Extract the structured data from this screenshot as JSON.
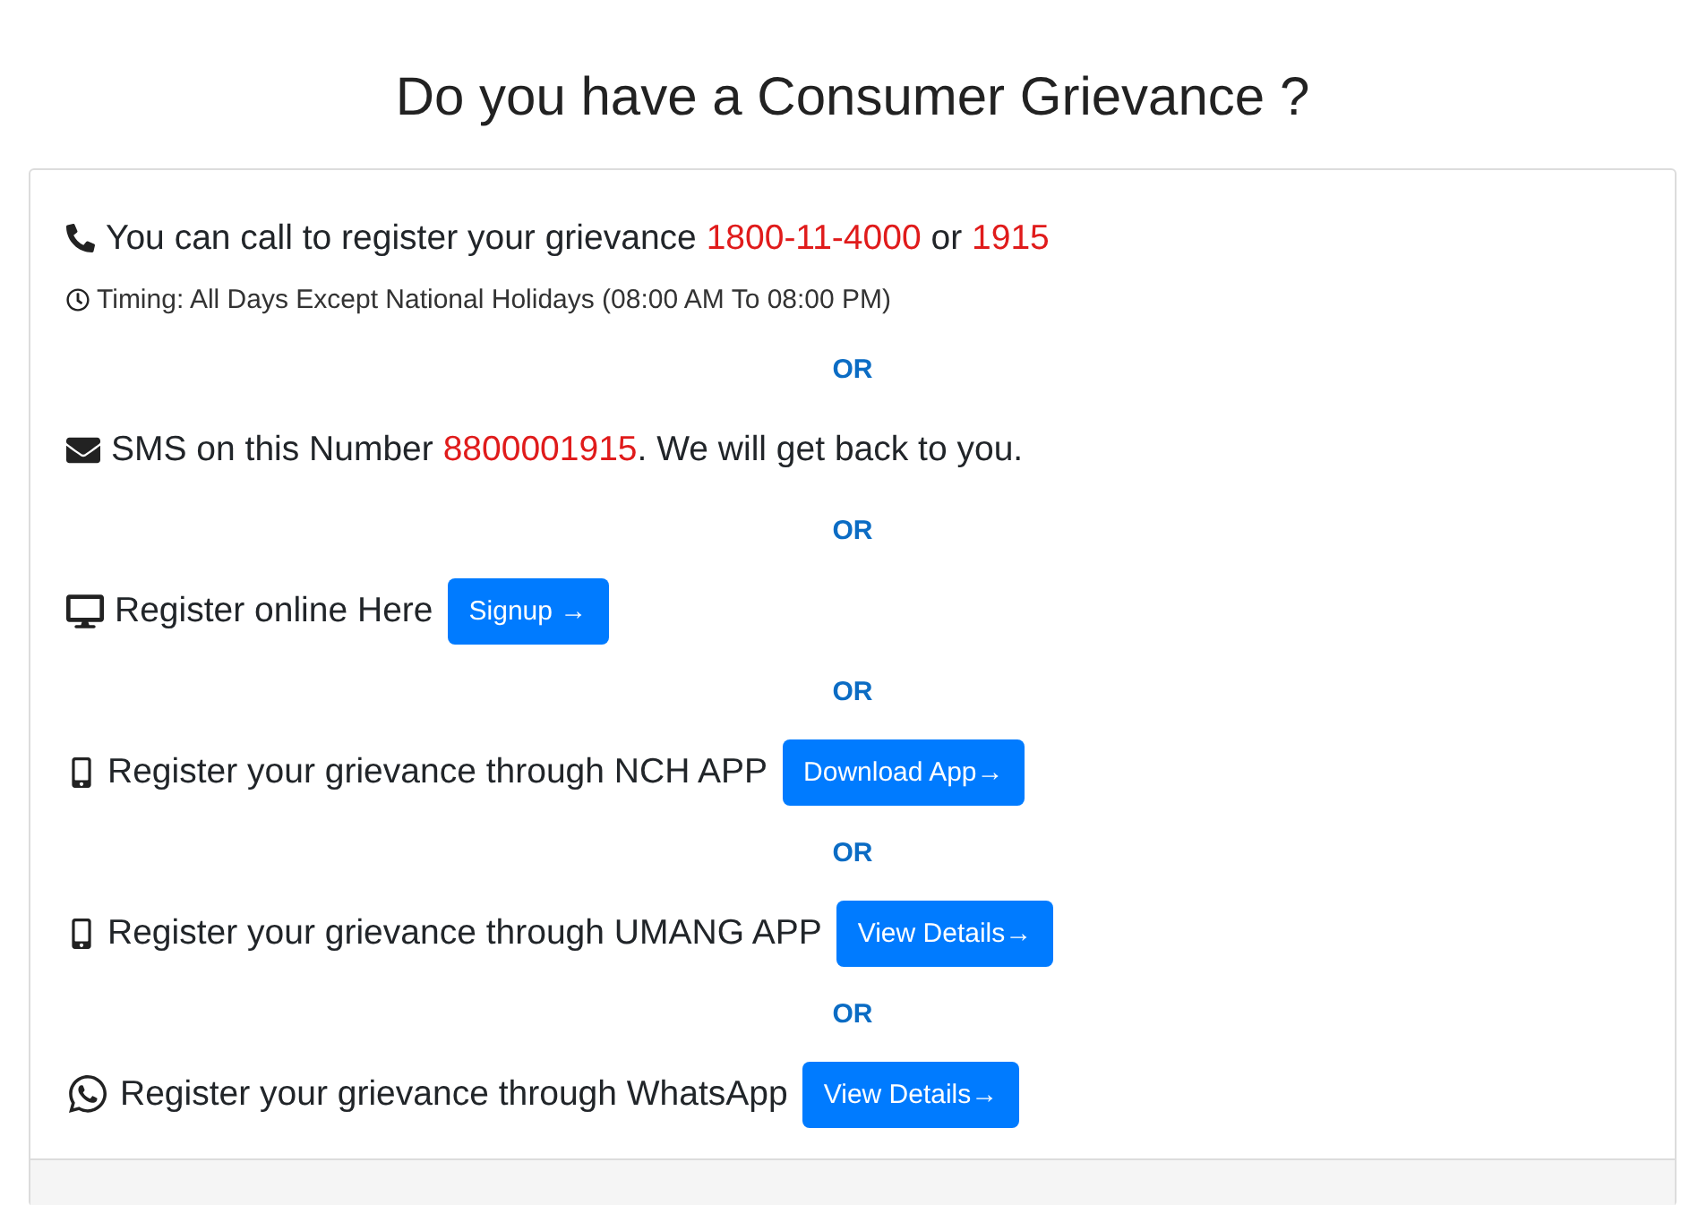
{
  "title": "Do you have a Consumer Grievance ?",
  "items": [
    {
      "kind": "call",
      "segments": [
        {
          "text": "You can call to register your grievance ",
          "highlight": false
        },
        {
          "text": "1800-11-4000",
          "highlight": true
        },
        {
          "text": " or ",
          "highlight": false
        },
        {
          "text": "1915",
          "highlight": true
        }
      ],
      "note": "Timing: All Days Except National Holidays (08:00 AM To 08:00 PM)"
    },
    {
      "kind": "or",
      "text": "OR"
    },
    {
      "kind": "sms",
      "segments": [
        {
          "text": "SMS on this Number ",
          "highlight": false
        },
        {
          "text": "8800001915",
          "highlight": true
        },
        {
          "text": ". We will get back to you.",
          "highlight": false
        }
      ]
    },
    {
      "kind": "or",
      "text": "OR"
    },
    {
      "kind": "online",
      "segments": [
        {
          "text": "Register online Here",
          "highlight": false
        }
      ],
      "button": "Signup →"
    },
    {
      "kind": "or",
      "text": "OR"
    },
    {
      "kind": "mobile",
      "segments": [
        {
          "text": "Register your grievance through NCH APP",
          "highlight": false
        }
      ],
      "button": "Download App→"
    },
    {
      "kind": "or",
      "text": "OR"
    },
    {
      "kind": "mobile",
      "segments": [
        {
          "text": "Register your grievance through UMANG APP",
          "highlight": false
        }
      ],
      "button": "View Details→"
    },
    {
      "kind": "or",
      "text": "OR"
    },
    {
      "kind": "whatsapp",
      "segments": [
        {
          "text": "Register your grievance through WhatsApp",
          "highlight": false
        }
      ],
      "button": "View Details→"
    }
  ]
}
